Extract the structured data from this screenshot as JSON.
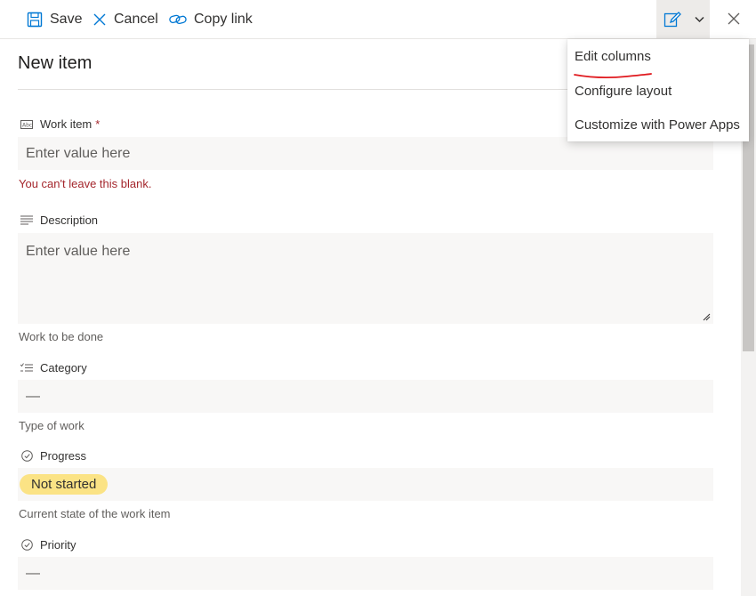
{
  "toolbar": {
    "save_label": "Save",
    "cancel_label": "Cancel",
    "copy_link_label": "Copy link"
  },
  "form": {
    "title": "New item",
    "fields": [
      {
        "label": "Work item",
        "required_mark": "*",
        "icon": "text-field-icon",
        "placeholder": "Enter value here",
        "error": "You can't leave this blank."
      },
      {
        "label": "Description",
        "icon": "multiline-text-icon",
        "placeholder": "Enter value here",
        "hint": "Work to be done"
      },
      {
        "label": "Category",
        "icon": "choice-list-icon",
        "value": "—",
        "hint": "Type of work"
      },
      {
        "label": "Progress",
        "icon": "check-circle-icon",
        "value": "Not started",
        "hint": "Current state of the work item",
        "pill_color": "#fbe385"
      },
      {
        "label": "Priority",
        "icon": "check-circle-icon",
        "value": "—"
      }
    ]
  },
  "menu": {
    "items": [
      {
        "label": "Edit columns"
      },
      {
        "label": "Configure layout"
      },
      {
        "label": "Customize with Power Apps"
      }
    ],
    "annotation_color": "#e0191e"
  },
  "colors": {
    "accent": "#0078d4",
    "error": "#a4262c",
    "field_bg": "#f8f7f6"
  }
}
